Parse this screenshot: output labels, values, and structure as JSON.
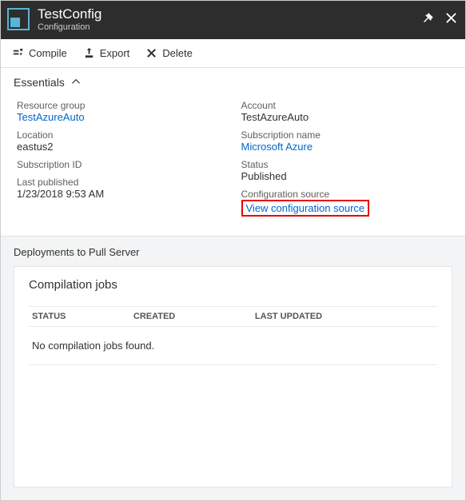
{
  "header": {
    "title": "TestConfig",
    "subtitle": "Configuration"
  },
  "toolbar": {
    "compile": "Compile",
    "export": "Export",
    "delete": "Delete"
  },
  "essentials": {
    "label": "Essentials",
    "left": {
      "resource_group_label": "Resource group",
      "resource_group_value": "TestAzureAuto",
      "location_label": "Location",
      "location_value": "eastus2",
      "subscription_id_label": "Subscription ID",
      "last_published_label": "Last published",
      "last_published_value": "1/23/2018 9:53 AM"
    },
    "right": {
      "account_label": "Account",
      "account_value": "TestAzureAuto",
      "subscription_name_label": "Subscription name",
      "subscription_name_value": "Microsoft Azure",
      "status_label": "Status",
      "status_value": "Published",
      "config_source_label": "Configuration source",
      "config_source_link": "View configuration source"
    }
  },
  "deployments": {
    "section_title": "Deployments to Pull Server",
    "panel_title": "Compilation jobs",
    "columns": {
      "status": "STATUS",
      "created": "CREATED",
      "last_updated": "LAST UPDATED"
    },
    "empty_message": "No compilation jobs found."
  }
}
